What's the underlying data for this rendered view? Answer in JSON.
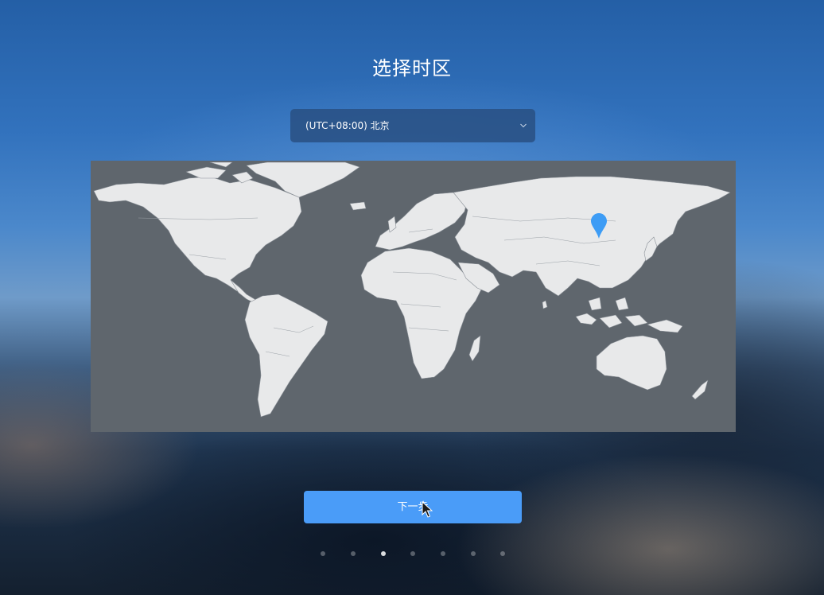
{
  "page": {
    "title": "选择时区"
  },
  "timezone_select": {
    "value": "(UTC+08:00) 北京",
    "icon": "chevron-down-icon"
  },
  "map": {
    "marker_icon": "location-pin-icon",
    "marker_color": "#3d9cf5",
    "land_color": "#e8e9ea",
    "ocean_color": "#5f666d"
  },
  "actions": {
    "next_label": "下一步"
  },
  "pagination": {
    "total": 7,
    "current": 3
  },
  "colors": {
    "accent": "#4a9cf8"
  }
}
